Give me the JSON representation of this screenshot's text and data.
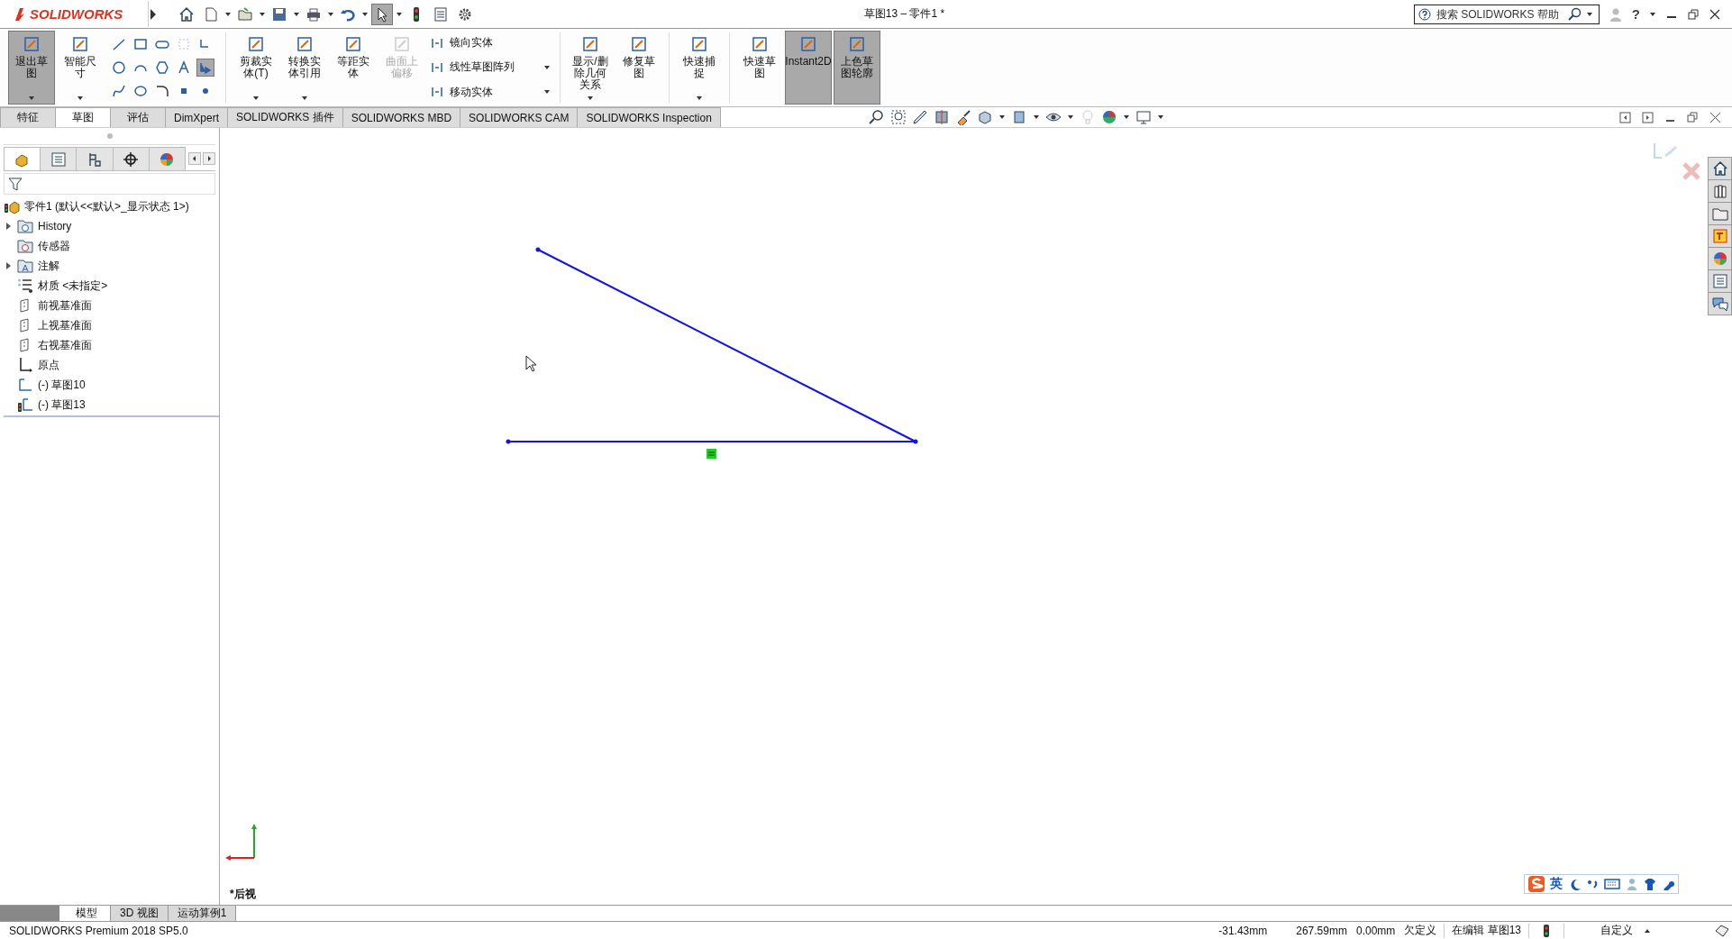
{
  "window": {
    "title": "草图13 – 零件1 *",
    "logo": "SOLIDWORKS"
  },
  "search": {
    "placeholder": "搜索 SOLIDWORKS 帮助"
  },
  "help_mark": "?",
  "quick_access": [
    {
      "kind": "home",
      "selected": false
    },
    {
      "kind": "new",
      "selected": false
    },
    {
      "kind": "open",
      "selected": false
    },
    {
      "kind": "save",
      "selected": false
    },
    {
      "kind": "print",
      "selected": false
    },
    {
      "kind": "undo",
      "selected": false
    },
    {
      "kind": "select",
      "selected": true
    },
    {
      "kind": "light",
      "selected": false
    },
    {
      "kind": "list",
      "selected": false
    },
    {
      "kind": "gear",
      "selected": false
    }
  ],
  "ribbon": [
    {
      "kind": "large",
      "label": "退出草图",
      "selected": true,
      "disabled": false,
      "dropdown": true
    },
    {
      "kind": "large",
      "label": "智能尺寸",
      "selected": false,
      "disabled": false,
      "dropdown": true
    },
    {
      "kind": "grid",
      "tools": [
        {
          "selected": false
        },
        {
          "selected": false
        },
        {
          "selected": false
        },
        {
          "selected": false
        },
        {
          "selected": false
        },
        {
          "selected": false
        },
        {
          "selected": false
        },
        {
          "selected": false
        },
        {
          "selected": false
        },
        {
          "selected": false
        },
        {
          "selected": false
        },
        {
          "selected": false
        },
        {
          "selected": false
        },
        {
          "selected": true
        },
        {
          "selected": false
        }
      ]
    },
    {
      "kind": "sep"
    },
    {
      "kind": "large",
      "label": "剪裁实体(T)",
      "selected": false,
      "disabled": false,
      "dropdown": true
    },
    {
      "kind": "large",
      "label": "转换实体引用",
      "selected": false,
      "disabled": false,
      "dropdown": true
    },
    {
      "kind": "large",
      "label": "等距实体",
      "selected": false,
      "disabled": false,
      "dropdown": false
    },
    {
      "kind": "large",
      "label": "曲面上偏移",
      "selected": false,
      "disabled": true,
      "dropdown": false
    },
    {
      "kind": "rows",
      "items": [
        {
          "label": "镜向实体",
          "dropdown": false
        },
        {
          "label": "线性草图阵列",
          "dropdown": true
        },
        {
          "label": "移动实体",
          "dropdown": true
        }
      ]
    },
    {
      "kind": "sep"
    },
    {
      "kind": "large",
      "label": "显示/删除几何关系",
      "selected": false,
      "disabled": false,
      "dropdown": true
    },
    {
      "kind": "large",
      "label": "修复草图",
      "selected": false,
      "disabled": false,
      "dropdown": false
    },
    {
      "kind": "sep"
    },
    {
      "kind": "large",
      "label": "快速捕捉",
      "selected": false,
      "disabled": false,
      "dropdown": true
    },
    {
      "kind": "sep"
    },
    {
      "kind": "large",
      "label": "快速草图",
      "selected": false,
      "disabled": false,
      "dropdown": false
    },
    {
      "kind": "large",
      "label": "Instant2D",
      "selected": true,
      "disabled": false,
      "dropdown": false
    },
    {
      "kind": "large",
      "label": "上色草图轮廓",
      "selected": true,
      "disabled": false,
      "dropdown": false
    }
  ],
  "command_tabs": [
    {
      "label": "特征",
      "selected": false
    },
    {
      "label": "草图",
      "selected": true
    },
    {
      "label": "评估",
      "selected": false
    },
    {
      "label": "DimXpert",
      "selected": false
    },
    {
      "label": "SOLIDWORKS 插件",
      "selected": false
    },
    {
      "label": "SOLIDWORKS MBD",
      "selected": false
    },
    {
      "label": "SOLIDWORKS CAM",
      "selected": false
    },
    {
      "label": "SOLIDWORKS Inspection",
      "selected": false
    }
  ],
  "manager_tabs": [
    {
      "kind": "feature",
      "selected": true
    },
    {
      "kind": "property",
      "selected": false
    },
    {
      "kind": "config",
      "selected": false
    },
    {
      "kind": "dim",
      "selected": false
    },
    {
      "kind": "display",
      "selected": false
    }
  ],
  "tree": {
    "root": "零件1  (默认<<默认>_显示状态 1>)",
    "items": [
      {
        "kind": "history",
        "label": "History",
        "expandable": true
      },
      {
        "kind": "sensor",
        "label": "传感器",
        "expandable": false
      },
      {
        "kind": "annotation",
        "label": "注解",
        "expandable": true
      },
      {
        "kind": "material",
        "label": "材质 <未指定>",
        "expandable": false
      },
      {
        "kind": "plane",
        "label": "前视基准面",
        "expandable": false
      },
      {
        "kind": "plane",
        "label": "上视基准面",
        "expandable": false
      },
      {
        "kind": "plane",
        "label": "右视基准面",
        "expandable": false
      },
      {
        "kind": "origin",
        "label": "原点",
        "expandable": false
      },
      {
        "kind": "sketch",
        "label": "(-) 草图10",
        "expandable": false
      },
      {
        "kind": "sketch-active",
        "label": "(-) 草图13",
        "expandable": false
      }
    ]
  },
  "view_label": "*后视",
  "ime": {
    "label": "英"
  },
  "bottom_tabs": [
    {
      "label": "模型",
      "selected": true
    },
    {
      "label": "3D 视图",
      "selected": false
    },
    {
      "label": "运动算例1",
      "selected": false
    }
  ],
  "status_bar": {
    "app": "SOLIDWORKS Premium 2018 SP5.0",
    "x": "-31.43mm",
    "y": "267.59mm",
    "z": "0.00mm",
    "state": "欠定义",
    "editing": "在编辑 草图13",
    "units": "自定义"
  }
}
